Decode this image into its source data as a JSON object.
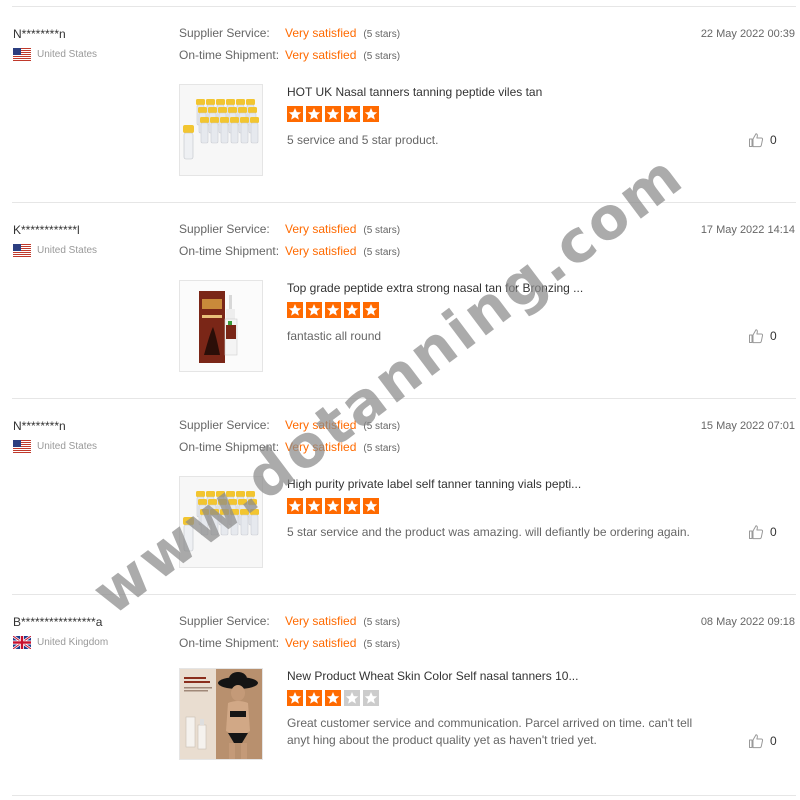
{
  "reviews": [
    {
      "user": "N********n",
      "country": "United States",
      "flag": "us",
      "supplier_label": "Supplier Service:",
      "supplier_value": "Very satisfied",
      "supplier_stars": "(5 stars)",
      "shipment_label": "On-time Shipment:",
      "shipment_value": "Very satisfied",
      "shipment_stars": "(5 stars)",
      "date": "22 May 2022 00:39",
      "product_title": "HOT UK Nasal tanners tanning peptide viles tan",
      "rating": 5,
      "comment": "5 service and 5 star product.",
      "likes": "0",
      "image": "vials"
    },
    {
      "user": "K************l",
      "country": "United States",
      "flag": "us",
      "supplier_label": "Supplier Service:",
      "supplier_value": "Very satisfied",
      "supplier_stars": "(5 stars)",
      "shipment_label": "On-time Shipment:",
      "shipment_value": "Very satisfied",
      "shipment_stars": "(5 stars)",
      "date": "17 May 2022 14:14",
      "product_title": "Top grade peptide extra strong nasal tan for Bronzing ...",
      "rating": 5,
      "comment": "fantastic all round",
      "likes": "0",
      "image": "spray-box"
    },
    {
      "user": "N********n",
      "country": "United States",
      "flag": "us",
      "supplier_label": "Supplier Service:",
      "supplier_value": "Very satisfied",
      "supplier_stars": "(5 stars)",
      "shipment_label": "On-time Shipment:",
      "shipment_value": "Very satisfied",
      "shipment_stars": "(5 stars)",
      "date": "15 May 2022 07:01",
      "product_title": "High purity private label self tanner tanning vials pepti...",
      "rating": 5,
      "comment": "5 star service and the product was amazing. will defiantly be ordering again.",
      "likes": "0",
      "image": "vials"
    },
    {
      "user": "B****************a",
      "country": "United Kingdom",
      "flag": "uk",
      "supplier_label": "Supplier Service:",
      "supplier_value": "Very satisfied",
      "supplier_stars": "(5 stars)",
      "shipment_label": "On-time Shipment:",
      "shipment_value": "Very satisfied",
      "shipment_stars": "(5 stars)",
      "date": "08 May 2022 09:18",
      "product_title": "New Product Wheat Skin Color Self nasal tanners 10...",
      "rating": 3,
      "comment": "Great customer service and communication. Parcel arrived on time. can't tell anyt hing about the product quality yet as haven't tried yet.",
      "likes": "0",
      "image": "model"
    }
  ],
  "watermark": "www.dotanning.com",
  "colors": {
    "accent": "#ff6a00",
    "star_empty": "#cccccc",
    "watermark": "#8a8a8a"
  }
}
